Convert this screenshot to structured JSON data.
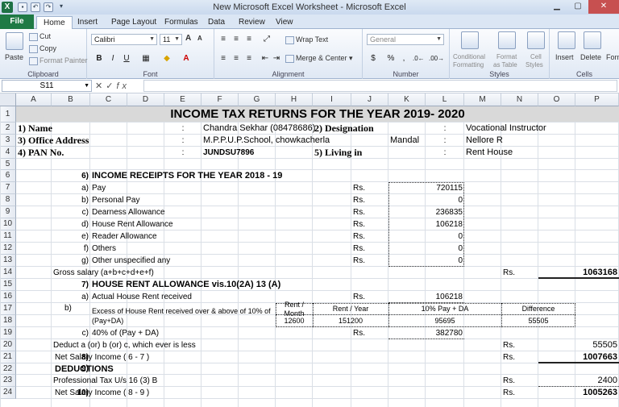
{
  "window": {
    "title": "New Microsoft Excel Worksheet  -  Microsoft Excel",
    "app_icon": "X"
  },
  "tabs": [
    {
      "label": "File"
    },
    {
      "label": "Home"
    },
    {
      "label": "Insert"
    },
    {
      "label": "Page Layout"
    },
    {
      "label": "Formulas"
    },
    {
      "label": "Data"
    },
    {
      "label": "Review"
    },
    {
      "label": "View"
    }
  ],
  "ribbon": {
    "clipboard": {
      "paste": "Paste",
      "cut": "Cut",
      "copy": "Copy",
      "format_painter": "Format Painter",
      "label": "Clipboard"
    },
    "font": {
      "name": "Calibri",
      "size": "11",
      "grow": "A",
      "shrink": "A",
      "bold": "B",
      "italic": "I",
      "underline": "U",
      "label": "Font"
    },
    "alignment": {
      "wrap": "Wrap Text",
      "merge": "Merge & Center",
      "label": "Alignment"
    },
    "number": {
      "format": "General",
      "currency": "$",
      "percent": "%",
      "comma": ",",
      "label": "Number"
    },
    "styles": {
      "conditional": "Conditional",
      "conditional2": "Formatting",
      "as_table": "Format",
      "as_table2": "as Table",
      "cell_styles": "Cell",
      "cell_styles2": "Styles",
      "label": "Styles"
    },
    "cells": {
      "insert": "Insert",
      "delete": "Delete",
      "format": "Form",
      "label": "Cells"
    }
  },
  "formula_bar": {
    "name_box": "S11",
    "fx": "fx"
  },
  "columns": [
    "A",
    "B",
    "C",
    "D",
    "E",
    "F",
    "G",
    "H",
    "I",
    "J",
    "K",
    "L",
    "M",
    "N",
    "O",
    "P"
  ],
  "rows": [
    "1",
    "2",
    "3",
    "4",
    "5",
    "6",
    "7",
    "8",
    "9",
    "10",
    "11",
    "12",
    "13",
    "14",
    "15",
    "16",
    "17",
    "18",
    "19",
    "20",
    "21",
    "22",
    "23",
    "24"
  ],
  "sheet": {
    "title": "INCOME TAX RETURNS FOR THE YEAR  2019- 2020",
    "r2": {
      "label": "1) Name",
      "colon": ":",
      "name": "Chandra Sekhar (08478686)",
      "label2": "2) Designation",
      "colon2": ":",
      "designation": "Vocational Instructor"
    },
    "r3": {
      "label": "3) Office Address",
      "colon": ":",
      "address": "M.P.P.U.P.School, chowkacherla",
      "mandal": "Mandal",
      "colon2": ":",
      "place": "Nellore R"
    },
    "r4": {
      "label": "4) PAN No.",
      "colon": ":",
      "pan": "JUNDSU7896",
      "label2": "5) Living in",
      "colon2": ":",
      "living": "Rent House"
    },
    "r6": {
      "num": "6)",
      "heading": "INCOME RECEIPTS FOR THE YEAR 2018 - 19"
    },
    "receipts": [
      {
        "letter": "a)",
        "label": "Pay",
        "rs": "Rs.",
        "value": "720115"
      },
      {
        "letter": "b)",
        "label": "Personal Pay",
        "rs": "Rs.",
        "value": "0"
      },
      {
        "letter": "c)",
        "label": "Dearness Allowance",
        "rs": "Rs.",
        "value": "236835"
      },
      {
        "letter": "d)",
        "label": "House Rent Allowance",
        "rs": "Rs.",
        "value": "106218"
      },
      {
        "letter": "e)",
        "label": "Reader Allowance",
        "rs": "Rs.",
        "value": "0"
      },
      {
        "letter": "f)",
        "label": "Others",
        "rs": "Rs.",
        "value": "0"
      },
      {
        "letter": "g)",
        "label": "Other unspecified any",
        "rs": "Rs.",
        "value": "0"
      }
    ],
    "r14": {
      "label": "Gross salary (a+b+c+d+e+f)",
      "rs": "Rs.",
      "value": "1063168"
    },
    "r15": {
      "num": "7)",
      "heading": "HOUSE RENT ALLOWANCE vis.10(2A) 13 (A)"
    },
    "r16": {
      "letter": "a)",
      "label": "Actual House Rent received",
      "rs": "Rs.",
      "value": "106218"
    },
    "r17": {
      "letter": "b)",
      "label": "Excess of House Rent received over & above of 10% of (Pay+DA)",
      "h_rent_month": "Rent / Month",
      "h_rent_year": "Rent / Year",
      "h_pay_da": "10% Pay + DA",
      "h_diff": "Difference",
      "v_rent_month": "12600",
      "v_rent_year": "151200",
      "v_pay_da": "95695",
      "v_diff": "55505"
    },
    "r19": {
      "letter": "c)",
      "label": "40% of (Pay + DA)",
      "rs": "Rs.",
      "value": "382780"
    },
    "r20": {
      "label": "Deduct a (or) b (or) c, which ever is less",
      "rs": "Rs.",
      "value": "55505"
    },
    "r21": {
      "num": "8)",
      "label": "Net Salary Income  ( 6 - 7 )",
      "rs": "Rs.",
      "value": "1007663"
    },
    "r22": {
      "num": "9)",
      "heading": "DEDUCTIONS"
    },
    "r23": {
      "label": "Professional Tax U/s 16 (3) B",
      "rs": "Rs.",
      "value": "2400"
    },
    "r24": {
      "num": "10)",
      "label": "Net Salary Income  ( 8 - 9 )",
      "rs": "Rs.",
      "value": "1005263"
    }
  }
}
